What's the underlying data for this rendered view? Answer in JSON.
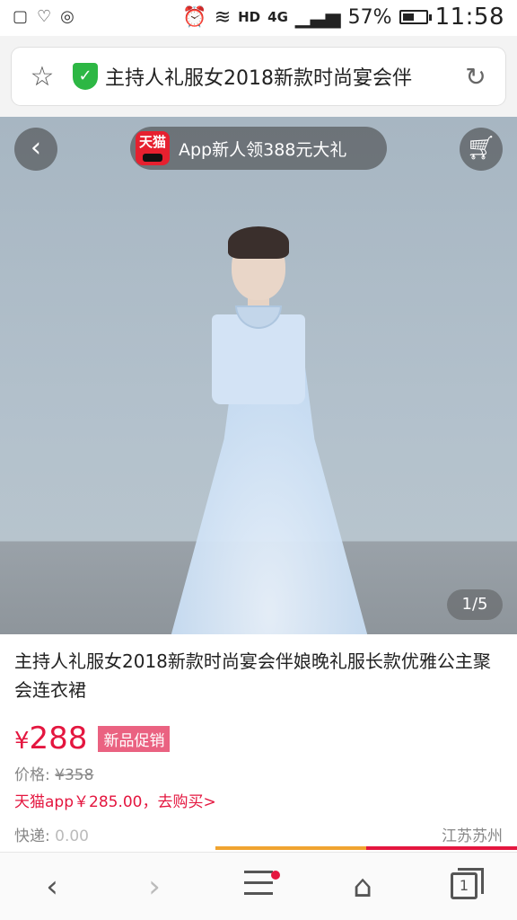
{
  "status_bar": {
    "left_icons": [
      "notification-icon",
      "heart-icon",
      "sync-icon"
    ],
    "network": "HD",
    "signal_label": "4G",
    "battery": "57%",
    "battery_level": 0.57,
    "time": "11:58"
  },
  "url_bar": {
    "title": "主持人礼服女2018新款时尚宴会伴"
  },
  "hero": {
    "promo": "App新人领388元大礼",
    "logo_text": "天猫",
    "pager": "1/5"
  },
  "product": {
    "title": "主持人礼服女2018新款时尚宴会伴娘晚礼服长款优雅公主聚会连衣裙",
    "currency": "¥",
    "price": "288",
    "tag": "新品促销",
    "old_price_label": "价格: ",
    "old_price": "¥358",
    "app_offer": "天猫app￥285.00，去购买>",
    "shipping_label": "快递: ",
    "shipping_fee": "0.00",
    "location": "江苏苏州"
  },
  "nav": {
    "tab_count": "1"
  }
}
